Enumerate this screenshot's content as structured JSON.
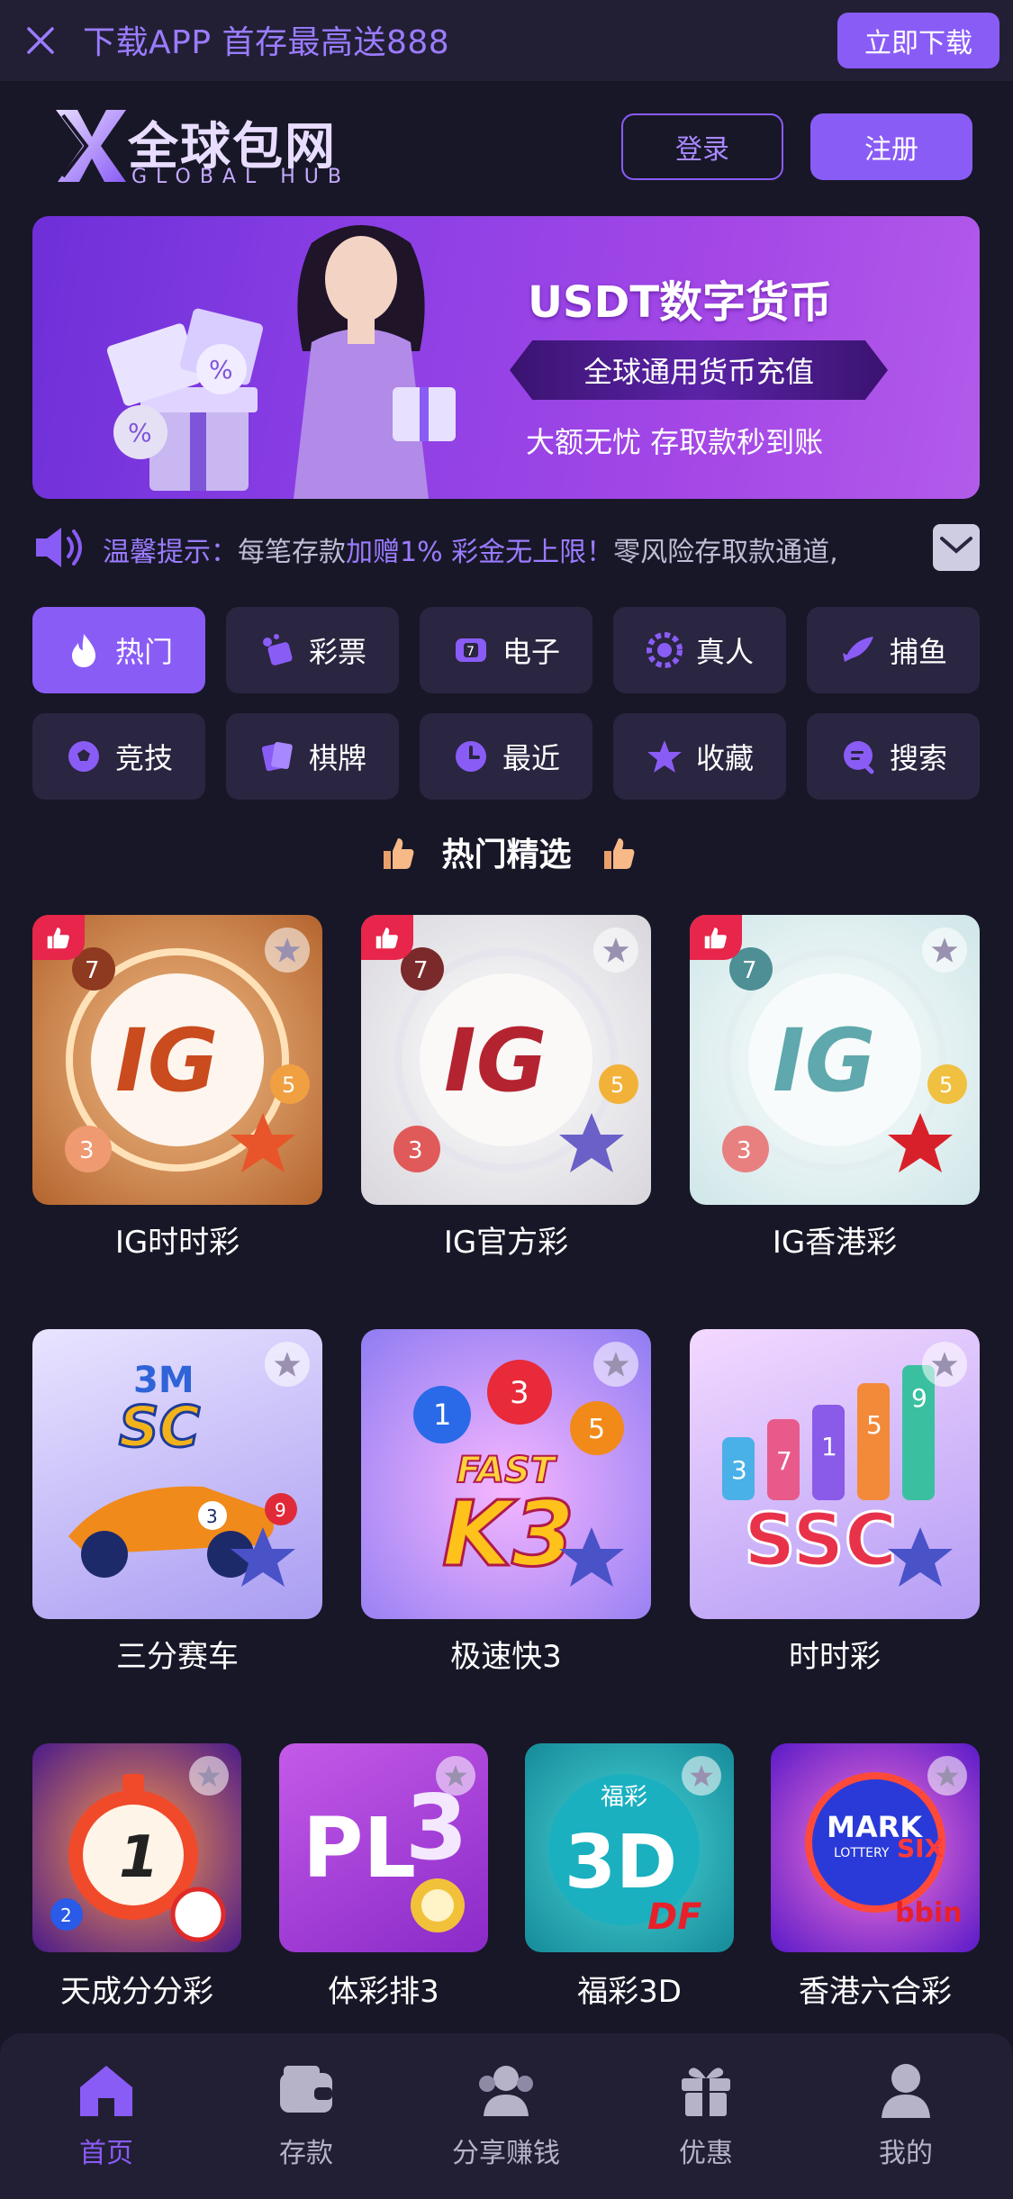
{
  "topbar": {
    "title": "下载APP 首存最高送888",
    "download_label": "立即下载"
  },
  "header": {
    "logo_cn": "全球包网",
    "logo_en": "GLOBAL HUB",
    "login_label": "登录",
    "register_label": "注册"
  },
  "banner": {
    "title": "USDT数字货币",
    "ribbon": "全球通用货币充值",
    "subtitle": "大额无忧 存取款秒到账"
  },
  "notice": {
    "prefix": "温馨提示：",
    "part1": "每笔存款",
    "highlight1": "加赠1% 彩金无上限！",
    "part2": "零风险存取款通道,"
  },
  "categories": [
    {
      "label": "热门",
      "icon": "fire-icon",
      "active": true
    },
    {
      "label": "彩票",
      "icon": "lottery-icon",
      "active": false
    },
    {
      "label": "电子",
      "icon": "slot-icon",
      "active": false
    },
    {
      "label": "真人",
      "icon": "casino-chip-icon",
      "active": false
    },
    {
      "label": "捕鱼",
      "icon": "fish-icon",
      "active": false
    },
    {
      "label": "竞技",
      "icon": "soccer-icon",
      "active": false
    },
    {
      "label": "棋牌",
      "icon": "cards-icon",
      "active": false
    },
    {
      "label": "最近",
      "icon": "clock-icon",
      "active": false
    },
    {
      "label": "收藏",
      "icon": "star-icon",
      "active": false
    },
    {
      "label": "搜索",
      "icon": "search-icon",
      "active": false
    }
  ],
  "section_title": "热门精选",
  "games_row1": [
    {
      "label": "IG时时彩",
      "art": "IG"
    },
    {
      "label": "IG官方彩",
      "art": "IG"
    },
    {
      "label": "IG香港彩",
      "art": "IG"
    }
  ],
  "games_row2": [
    {
      "label": "三分赛车",
      "art": "3M SC"
    },
    {
      "label": "极速快3",
      "art": "FAST K3"
    },
    {
      "label": "时时彩",
      "art": "SSC"
    }
  ],
  "games_row3": [
    {
      "label": "天成分分彩",
      "art": "1"
    },
    {
      "label": "体彩排3",
      "art": "PL3"
    },
    {
      "label": "福彩3D",
      "art": "福彩 3D DF"
    },
    {
      "label": "香港六合彩",
      "art": "MARK SIX LOTTERY bbin"
    }
  ],
  "bottom_nav": [
    {
      "label": "首页",
      "icon": "home-icon",
      "active": true
    },
    {
      "label": "存款",
      "icon": "wallet-icon",
      "active": false
    },
    {
      "label": "分享赚钱",
      "icon": "users-icon",
      "active": false
    },
    {
      "label": "优惠",
      "icon": "gift-icon",
      "active": false
    },
    {
      "label": "我的",
      "icon": "profile-icon",
      "active": false
    }
  ],
  "colors": {
    "accent": "#8a5cf6",
    "background": "#181727",
    "panel": "#2a2540"
  }
}
